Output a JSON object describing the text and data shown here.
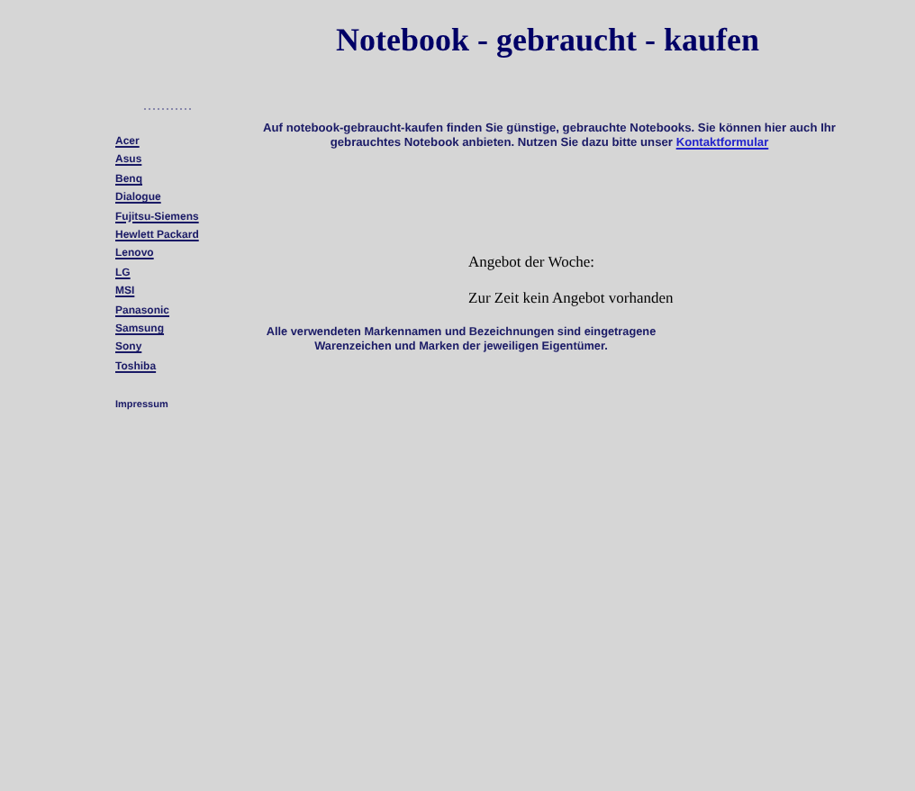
{
  "header": {
    "title": "Notebook - gebraucht - kaufen"
  },
  "sidebar": {
    "brands": [
      "Acer",
      "Asus",
      "Benq",
      "Dialogue",
      "Fujitsu-Siemens",
      "Hewlett Packard",
      "Lenovo",
      "LG",
      "MSI",
      "Panasonic",
      "Samsung",
      "Sony",
      "Toshiba"
    ],
    "footer_link": "Impressum"
  },
  "main": {
    "intro": "Auf notebook-gebraucht-kaufen finden Sie günstige, gebrauchte Notebooks. Sie können hier auch Ihr gebrauchtes Notebook anbieten. Nutzen Sie dazu bitte unser",
    "intro_link": "Kontaktformular",
    "offer_heading": "Angebot der Woche:",
    "offer_text": "Zur Zeit kein Angebot vorhanden",
    "disclaimer": "Alle verwendeten Markennamen und Bezeichnungen sind eingetragene Warenzeichen und Marken der jeweiligen Eigentümer."
  }
}
